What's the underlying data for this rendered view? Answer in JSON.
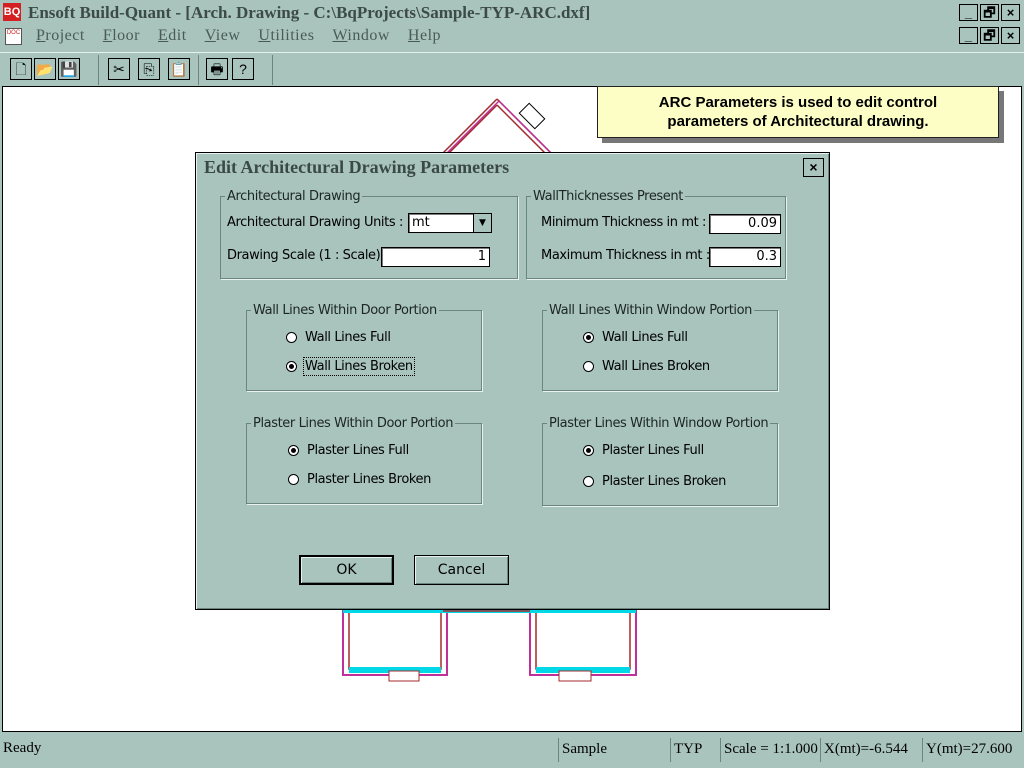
{
  "app": {
    "title": "Ensoft Build-Quant - [Arch. Drawing - C:\\BqProjects\\Sample-TYP-ARC.dxf]",
    "icon_text": "BQ",
    "doc_icon_text": "DOC",
    "window_buttons": [
      "_",
      "🗗",
      "×"
    ]
  },
  "menu": [
    "Project",
    "Floor",
    "Edit",
    "View",
    "Utilities",
    "Window",
    "Help"
  ],
  "toolbar": {
    "buttons": [
      {
        "name": "new-icon",
        "glyph": "🗋"
      },
      {
        "name": "open-folder-icon",
        "glyph": "📂"
      },
      {
        "name": "save-icon",
        "glyph": "💾"
      },
      {
        "name": "cut-icon",
        "glyph": "✂"
      },
      {
        "name": "copy-icon",
        "glyph": "⎘"
      },
      {
        "name": "paste-icon",
        "glyph": "📋"
      },
      {
        "name": "print-icon",
        "glyph": "🖶"
      },
      {
        "name": "help-icon",
        "glyph": "?"
      }
    ]
  },
  "callout": {
    "line1": "ARC Parameters is used to edit control",
    "line2": "parameters of  Architectural drawing."
  },
  "dialog": {
    "title": "Edit Architectural Drawing Parameters",
    "close": "×",
    "arch_group": {
      "legend": "Architectural Drawing",
      "units_label": "Architectural Drawing Units :",
      "units_value": "mt",
      "scale_label": "Drawing Scale (1 : Scale) :",
      "scale_value": "1"
    },
    "thick_group": {
      "legend": "WallThicknesses Present",
      "min_label": "Minimum Thickness in mt :",
      "min_value": "0.09",
      "max_label": "Maximum Thickness in mt :",
      "max_value": "0.3"
    },
    "wall_door": {
      "legend": "Wall Lines Within Door Portion",
      "opt1": "Wall Lines Full",
      "opt2": "Wall Lines Broken",
      "selected": 2
    },
    "wall_window": {
      "legend": "Wall Lines Within Window Portion",
      "opt1": "Wall Lines Full",
      "opt2": "Wall Lines Broken",
      "selected": 1
    },
    "plaster_door": {
      "legend": "Plaster Lines Within Door Portion",
      "opt1": "Plaster Lines Full",
      "opt2": "Plaster Lines Broken",
      "selected": 1
    },
    "plaster_window": {
      "legend": "Plaster Lines Within Window Portion",
      "opt1": "Plaster Lines Full",
      "opt2": "Plaster Lines Broken",
      "selected": 1
    },
    "ok": "OK",
    "cancel": "Cancel"
  },
  "status": {
    "ready": "Ready",
    "project": "Sample",
    "floor": "TYP",
    "scale": "Scale = 1:1.000",
    "x": "X(mt)=-6.544",
    "y": "Y(mt)=27.600"
  },
  "colors": {
    "chrome": "#a9c4bd",
    "callout_bg": "#fdfdc6",
    "wall_line": "#c0309a",
    "plaster_line": "#a52a2a",
    "window_fill": "#00d8e8"
  }
}
